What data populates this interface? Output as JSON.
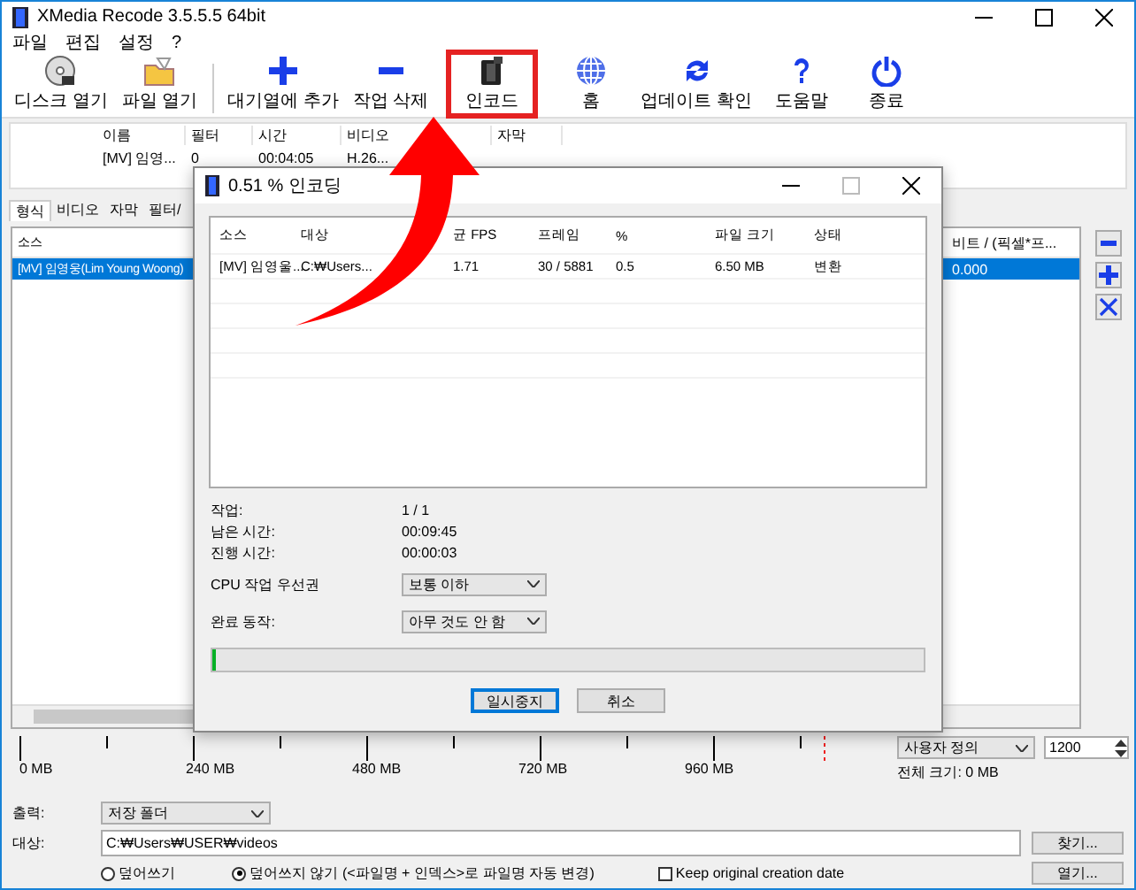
{
  "window": {
    "title": "XMedia Recode 3.5.5.5 64bit"
  },
  "menu": [
    "파일",
    "편집",
    "설정",
    "?"
  ],
  "toolbar": [
    {
      "label": "디스크 열기",
      "kind": "disc",
      "highlighted": false
    },
    {
      "label": "파일 열기",
      "kind": "folder",
      "highlighted": false
    },
    {
      "label": "대기열에 추가",
      "kind": "add",
      "highlighted": false
    },
    {
      "label": "작업 삭제",
      "kind": "remove",
      "highlighted": false
    },
    {
      "label": "인코드",
      "kind": "encode",
      "highlighted": true
    },
    {
      "label": "홈",
      "kind": "globe",
      "highlighted": false
    },
    {
      "label": "업데이트 확인",
      "kind": "update",
      "highlighted": false
    },
    {
      "label": "도움말",
      "kind": "help",
      "highlighted": false
    },
    {
      "label": "종료",
      "kind": "power",
      "highlighted": false
    }
  ],
  "queue": {
    "columns": [
      "이름",
      "필터",
      "시간",
      "비디오",
      "자막"
    ],
    "rows": [
      {
        "cells": [
          "[MV] 임영...",
          "0",
          "00:04:05",
          "H.26..."
        ],
        "selected": false
      }
    ]
  },
  "tabs": [
    {
      "label": "형식",
      "selected": true
    },
    {
      "label": "비디오",
      "selected": false
    },
    {
      "label": "자막",
      "selected": false
    },
    {
      "label": "필터/",
      "selected": false
    }
  ],
  "sources": {
    "columns": [
      "소스",
      "비트 / (픽셀*프..."
    ],
    "rows": [
      {
        "cells": [
          "[MV] 임영웅(Lim Young Woong)",
          "0.000"
        ],
        "selected": true
      }
    ]
  },
  "side_buttons": [
    {
      "kind": "remove"
    },
    {
      "kind": "add"
    },
    {
      "kind": "delete"
    }
  ],
  "size_bar": {
    "ticks": [
      "0 MB",
      "240 MB",
      "480 MB",
      "720 MB",
      "960 MB"
    ],
    "preset": "사용자 정의",
    "value": "1200",
    "total": "전체 크기: 0 MB"
  },
  "output": {
    "label": "출력:",
    "mode": "저장 폴더",
    "target_label": "대상:",
    "path": "C:₩Users₩USER₩videos",
    "browse": "찾기...",
    "open": "열기...",
    "options": [
      {
        "kind": "radio",
        "label": "덮어쓰기",
        "selected": false
      },
      {
        "kind": "radio",
        "label": "덮어쓰지 않기 (<파일명 + 인덱스>로 파일명 자동 변경)",
        "selected": true
      },
      {
        "kind": "checkbox",
        "label": "Keep original creation date",
        "checked": false
      }
    ]
  },
  "dialog": {
    "title": "0.51 % 인코딩",
    "columns": [
      "소스",
      "대상",
      "균 FPS",
      "프레임",
      "%",
      "파일 크기",
      "상태"
    ],
    "rows": [
      [
        "[MV] 임영울...",
        "C:₩Users...",
        "1.71",
        "30 / 5881",
        "0.5",
        "6.50 MB",
        "변환"
      ]
    ],
    "info": [
      {
        "label": "작업:",
        "value": "1 / 1"
      },
      {
        "label": "남은 시간:",
        "value": "00:09:45"
      },
      {
        "label": "진행 시간:",
        "value": "00:00:03"
      }
    ],
    "priority": {
      "label": "CPU 작업 우선권",
      "value": "보통 이하"
    },
    "completion": {
      "label": "완료 동작:",
      "value": "아무 것도 안 함"
    },
    "progress": {
      "level": 0.005
    },
    "buttons": [
      {
        "label": "일시중지",
        "default": true
      },
      {
        "label": "취소",
        "default": false
      }
    ]
  }
}
